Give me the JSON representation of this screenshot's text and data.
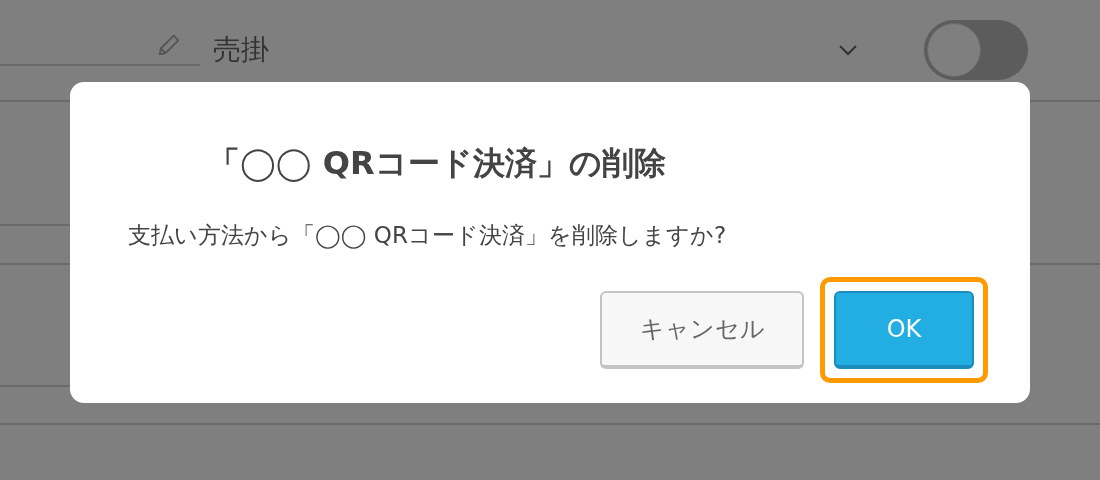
{
  "background": {
    "field": {
      "value": "売掛",
      "on": false
    }
  },
  "dialog": {
    "title": "「◯◯ QRコード決済」の削除",
    "message": "支払い方法から「◯◯ QRコード決済」を削除しますか?",
    "buttons": [
      {
        "label": "キャンセル",
        "kind": "secondary",
        "focused": false
      },
      {
        "label": "OK",
        "kind": "primary",
        "focused": true
      }
    ]
  }
}
